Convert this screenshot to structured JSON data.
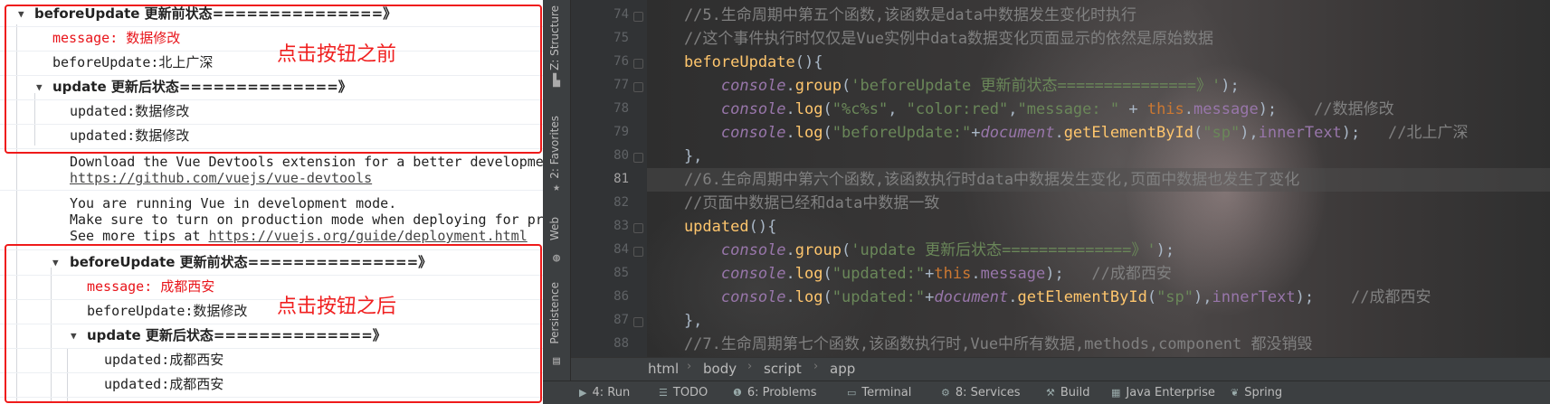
{
  "console": {
    "rows": [
      {
        "tri": "▼",
        "label": "beforeUpdate",
        "rest": " 更新前状态===============》"
      },
      {
        "text": "message: 数据修改"
      },
      {
        "text": "beforeUpdate:北上广深"
      },
      {
        "tri": "▼",
        "label": "update",
        "rest": " 更新后状态==============》"
      },
      {
        "text": "updated:数据修改"
      },
      {
        "text": "updated:数据修改"
      },
      {
        "line1": "Download the Vue Devtools extension for a better developme",
        "line2": "https://github.com/vuejs/vue-devtools"
      },
      {
        "line1": "You are running Vue in development mode.",
        "line2": "Make sure to turn on production mode when deploying for pr",
        "line3": "See more tips at ",
        "link": "https://vuejs.org/guide/deployment.html"
      },
      {
        "tri": "▼",
        "label": "beforeUpdate",
        "rest": " 更新前状态===============》"
      },
      {
        "text": "message: 成都西安"
      },
      {
        "text": "beforeUpdate:数据修改"
      },
      {
        "tri": "▼",
        "label": "update",
        "rest": " 更新后状态==============》"
      },
      {
        "text": "updated:成都西安"
      },
      {
        "text": "updated:成都西安"
      }
    ],
    "annotation_before": "点击按钮之前",
    "annotation_after": "点击按钮之后",
    "annotation_color": "#e8141a"
  },
  "toolstrip": {
    "tabs": [
      "Z: Structure",
      "2: Favorites",
      "Web",
      "Persistence"
    ]
  },
  "editor": {
    "line_numbers": [
      "74",
      "75",
      "76",
      "77",
      "78",
      "79",
      "80",
      "81",
      "82",
      "83",
      "84",
      "85",
      "86",
      "87",
      "88"
    ],
    "current_line": "81",
    "lines": [
      [
        [
          "cm",
          "    //5.生命周期中第五个函数,该函数是data中数据发生变化时执行"
        ]
      ],
      [
        [
          "cm",
          "    //这个事件执行时仅仅是Vue实例中data数据变化页面显示的依然是原始数据"
        ]
      ],
      [
        [
          "fn",
          "    beforeUpdate"
        ],
        [
          "df",
          "(){"
        ]
      ],
      [
        [
          "df",
          "        "
        ],
        [
          "ob",
          "console"
        ],
        [
          "df",
          "."
        ],
        [
          "fn",
          "group"
        ],
        [
          "df",
          "("
        ],
        [
          "st",
          "'beforeUpdate 更新前状态===============》'"
        ],
        [
          "df",
          ");"
        ]
      ],
      [
        [
          "df",
          "        "
        ],
        [
          "ob",
          "console"
        ],
        [
          "df",
          "."
        ],
        [
          "fn",
          "log"
        ],
        [
          "df",
          "("
        ],
        [
          "st",
          "\"%c%s\""
        ],
        [
          "df",
          ", "
        ],
        [
          "st",
          "\"color:red\""
        ],
        [
          "df",
          ","
        ],
        [
          "st",
          "\"message: \""
        ],
        [
          "df",
          " + "
        ],
        [
          "kw",
          "this"
        ],
        [
          "df",
          "."
        ],
        [
          "pr",
          "message"
        ],
        [
          "df",
          ");    "
        ],
        [
          "cm",
          "//数据修改"
        ]
      ],
      [
        [
          "df",
          "        "
        ],
        [
          "ob",
          "console"
        ],
        [
          "df",
          "."
        ],
        [
          "fn",
          "log"
        ],
        [
          "df",
          "("
        ],
        [
          "st",
          "\"beforeUpdate:\""
        ],
        [
          "df",
          "+"
        ],
        [
          "ob",
          "document"
        ],
        [
          "df",
          "."
        ],
        [
          "fn",
          "getElementById"
        ],
        [
          "df",
          "("
        ],
        [
          "st",
          "\"sp\""
        ],
        [
          "df",
          "),"
        ],
        [
          "pr",
          "innerText"
        ],
        [
          "df",
          ");   "
        ],
        [
          "cm",
          "//北上广深"
        ]
      ],
      [
        [
          "df",
          "    },"
        ]
      ],
      [
        [
          "cm",
          "    //6.生命周期中第六个函数,该函数执行时data中数据发生变化,页面中数据也发生了变化"
        ]
      ],
      [
        [
          "cm",
          "    //页面中数据已经和data中数据一致"
        ]
      ],
      [
        [
          "fn",
          "    updated"
        ],
        [
          "df",
          "(){"
        ]
      ],
      [
        [
          "df",
          "        "
        ],
        [
          "ob",
          "console"
        ],
        [
          "df",
          "."
        ],
        [
          "fn",
          "group"
        ],
        [
          "df",
          "("
        ],
        [
          "st",
          "'update 更新后状态==============》'"
        ],
        [
          "df",
          ");"
        ]
      ],
      [
        [
          "df",
          "        "
        ],
        [
          "ob",
          "console"
        ],
        [
          "df",
          "."
        ],
        [
          "fn",
          "log"
        ],
        [
          "df",
          "("
        ],
        [
          "st",
          "\"updated:\""
        ],
        [
          "df",
          "+"
        ],
        [
          "kw",
          "this"
        ],
        [
          "df",
          "."
        ],
        [
          "pr",
          "message"
        ],
        [
          "df",
          ");   "
        ],
        [
          "cm",
          "//成都西安"
        ]
      ],
      [
        [
          "df",
          "        "
        ],
        [
          "ob",
          "console"
        ],
        [
          "df",
          "."
        ],
        [
          "fn",
          "log"
        ],
        [
          "df",
          "("
        ],
        [
          "st",
          "\"updated:\""
        ],
        [
          "df",
          "+"
        ],
        [
          "ob",
          "document"
        ],
        [
          "df",
          "."
        ],
        [
          "fn",
          "getElementById"
        ],
        [
          "df",
          "("
        ],
        [
          "st",
          "\"sp\""
        ],
        [
          "df",
          "),"
        ],
        [
          "pr",
          "innerText"
        ],
        [
          "df",
          ");    "
        ],
        [
          "cm",
          "//成都西安"
        ]
      ],
      [
        [
          "df",
          "    },"
        ]
      ],
      [
        [
          "cm",
          "    //7.生命周期第七个函数,该函数执行时,Vue中所有数据,methods,component 都没销毁"
        ]
      ]
    ]
  },
  "breadcrumbs": [
    "html",
    "body",
    "script",
    "app"
  ],
  "bottom_tabs": [
    {
      "icon": "run-icon",
      "glyph": "▶",
      "label": "4: Run"
    },
    {
      "icon": "todo-icon",
      "glyph": "☰",
      "label": "TODO"
    },
    {
      "icon": "problems-icon",
      "glyph": "❶",
      "label": "6: Problems"
    },
    {
      "icon": "terminal-icon",
      "glyph": "▭",
      "label": "Terminal"
    },
    {
      "icon": "services-icon",
      "glyph": "⚙",
      "label": "8: Services"
    },
    {
      "icon": "build-icon",
      "glyph": "⚒",
      "label": "Build"
    },
    {
      "icon": "java-enterprise-icon",
      "glyph": "▦",
      "label": "Java Enterprise"
    },
    {
      "icon": "spring-icon",
      "glyph": "❦",
      "label": "Spring"
    }
  ]
}
